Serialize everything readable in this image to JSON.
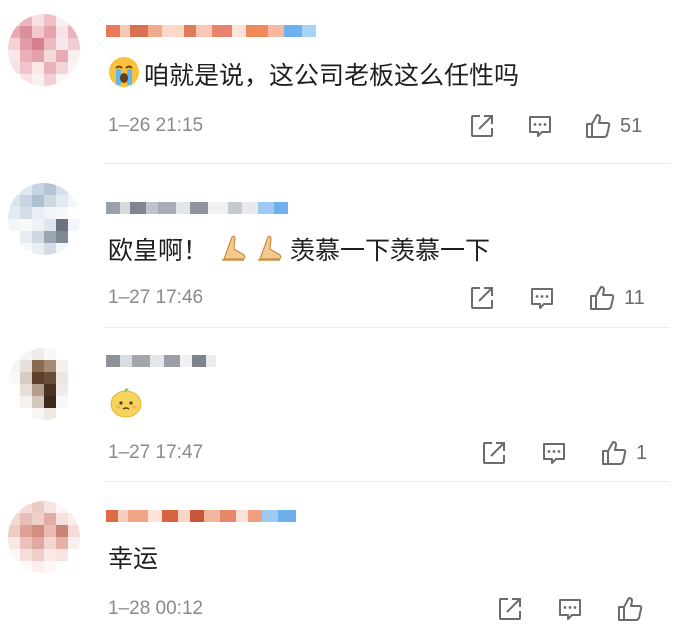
{
  "comments": [
    {
      "text": "咱就是说，这公司老板这么任性吗",
      "time": "1–26 21:15",
      "likes": "51",
      "emoji": "crying-face"
    },
    {
      "text": "欧皇啊！",
      "text2": "羡慕一下羡慕一下",
      "time": "1–27 17:46",
      "likes": "11",
      "emoji": "praying-hands"
    },
    {
      "text": "",
      "time": "1–27 17:47",
      "likes": "1",
      "emoji": "lemon-face"
    },
    {
      "text": "幸运",
      "time": "1–28 00:12",
      "likes": "",
      "emoji": ""
    }
  ],
  "icons": {
    "share": "share-icon",
    "reply": "comment-icon",
    "like": "thumbs-up-icon"
  },
  "colors": {
    "time": "#8a8a8a",
    "icon": "#6c6c6c",
    "text": "#1f1f1f"
  }
}
